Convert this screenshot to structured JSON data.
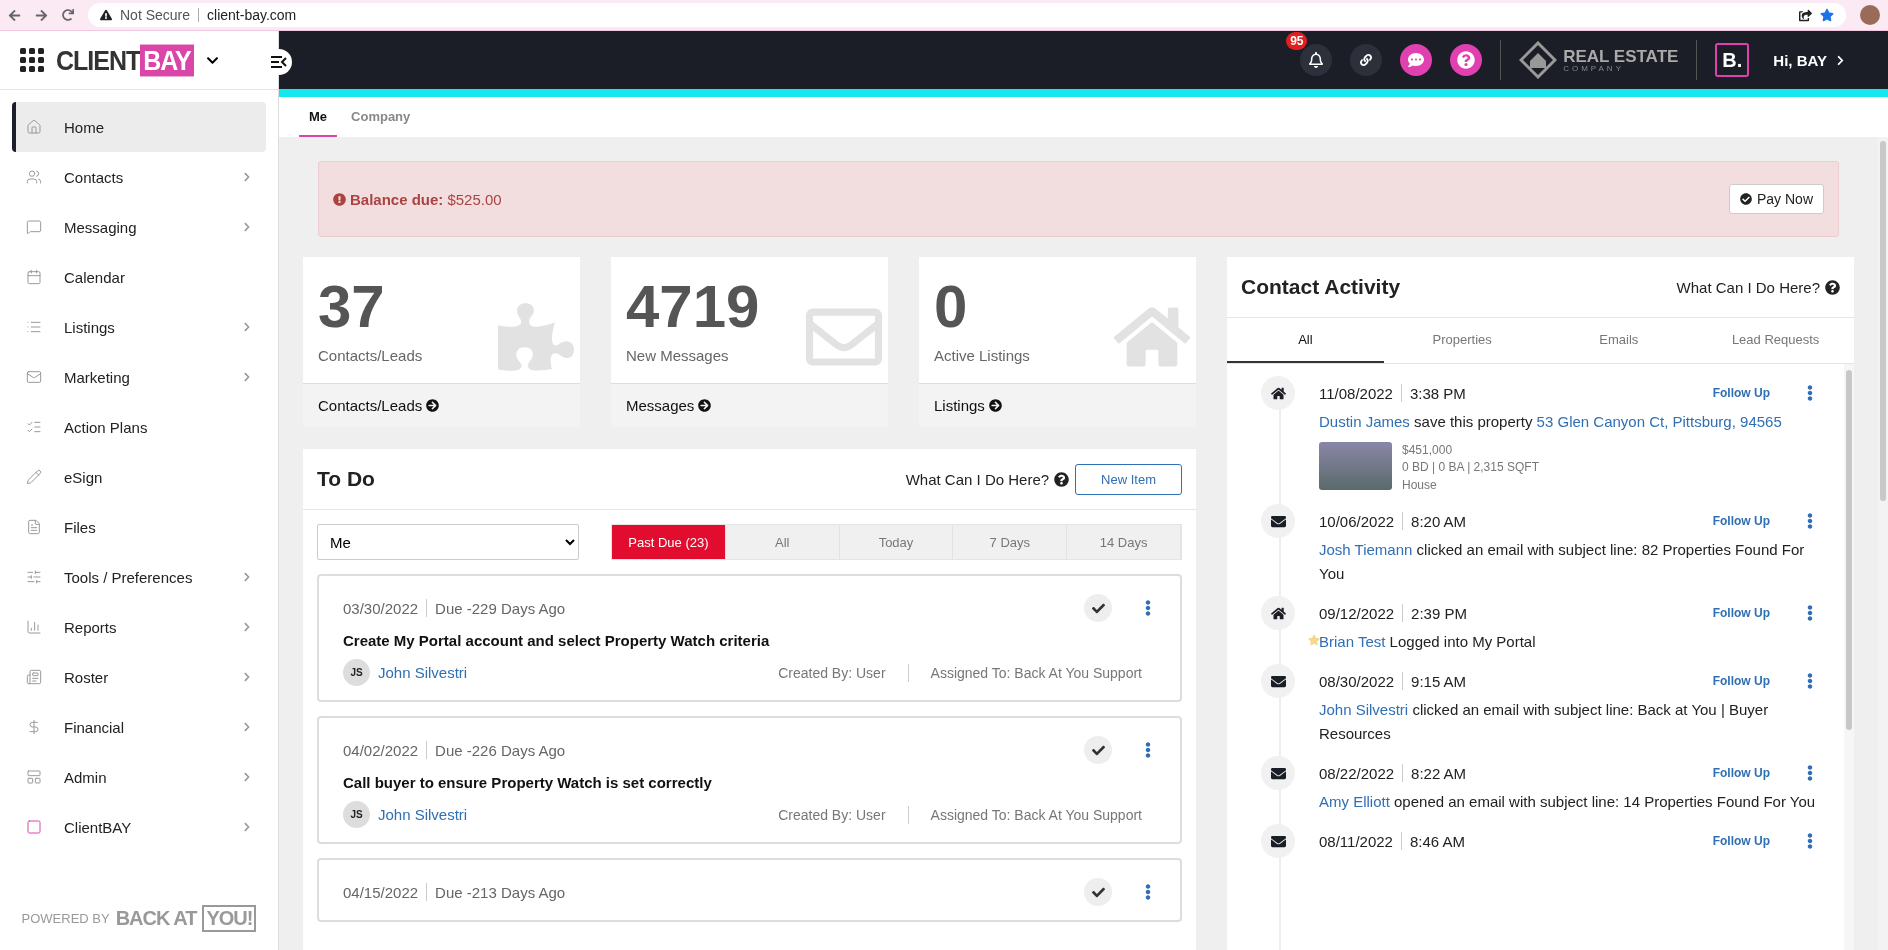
{
  "browser": {
    "security": "Not Secure",
    "url": "client-bay.com"
  },
  "sidebar": {
    "logo": {
      "word": "CLIENT",
      "highlight": "BAY"
    },
    "items": [
      {
        "label": "Home",
        "selected": true,
        "has_submenu": false
      },
      {
        "label": "Contacts",
        "selected": false,
        "has_submenu": true
      },
      {
        "label": "Messaging",
        "selected": false,
        "has_submenu": true
      },
      {
        "label": "Calendar",
        "selected": false,
        "has_submenu": false
      },
      {
        "label": "Listings",
        "selected": false,
        "has_submenu": true
      },
      {
        "label": "Marketing",
        "selected": false,
        "has_submenu": true
      },
      {
        "label": "Action Plans",
        "selected": false,
        "has_submenu": false
      },
      {
        "label": "eSign",
        "selected": false,
        "has_submenu": false
      },
      {
        "label": "Files",
        "selected": false,
        "has_submenu": false
      },
      {
        "label": "Tools / Preferences",
        "selected": false,
        "has_submenu": true
      },
      {
        "label": "Reports",
        "selected": false,
        "has_submenu": true
      },
      {
        "label": "Roster",
        "selected": false,
        "has_submenu": true
      },
      {
        "label": "Financial",
        "selected": false,
        "has_submenu": true
      },
      {
        "label": "Admin",
        "selected": false,
        "has_submenu": true
      },
      {
        "label": "ClientBAY",
        "selected": false,
        "has_submenu": true
      }
    ],
    "footer": {
      "prefix": "POWERED BY",
      "brand": "BACK AT",
      "brand_box": "YOU!"
    }
  },
  "header": {
    "notifications": "95",
    "company": {
      "name": "REAL ESTATE",
      "sub": "COMPANY"
    },
    "brand_mark": "B.",
    "greeting": "Hi, BAY"
  },
  "tabs": [
    {
      "label": "Me",
      "selected": true
    },
    {
      "label": "Company",
      "selected": false
    }
  ],
  "alert": {
    "label": "Balance due:",
    "amount": "$525.00",
    "button": "Pay Now"
  },
  "stats": [
    {
      "kind": "contacts",
      "value": "37",
      "caption": "Contacts/Leads",
      "link": "Contacts/Leads"
    },
    {
      "kind": "messages",
      "value": "4719",
      "caption": "New Messages",
      "link": "Messages"
    },
    {
      "kind": "listings",
      "value": "0",
      "caption": "Active Listings",
      "link": "Listings"
    }
  ],
  "todo": {
    "title": "To Do",
    "help": "What Can I Do Here?",
    "new_button": "New Item",
    "assignee": "Me",
    "filters": [
      {
        "label": "Past Due (23)",
        "selected": true
      },
      {
        "label": "All",
        "selected": false
      },
      {
        "label": "Today",
        "selected": false
      },
      {
        "label": "7 Days",
        "selected": false
      },
      {
        "label": "14 Days",
        "selected": false
      }
    ],
    "items": [
      {
        "date": "03/30/2022",
        "due": "Due -229 Days Ago",
        "title": "Create My Portal account and select Property Watch criteria",
        "initials": "JS",
        "contact": "John Silvestri",
        "created": "Created By: User",
        "assigned": "Assigned To: Back At You Support"
      },
      {
        "date": "04/02/2022",
        "due": "Due -226 Days Ago",
        "title": "Call buyer to ensure Property Watch is set correctly",
        "initials": "JS",
        "contact": "John Silvestri",
        "created": "Created By: User",
        "assigned": "Assigned To: Back At You Support"
      },
      {
        "date": "04/15/2022",
        "due": "Due -213 Days Ago"
      }
    ]
  },
  "activity": {
    "title": "Contact Activity",
    "help": "What Can I Do Here?",
    "tabs": [
      {
        "label": "All",
        "selected": true
      },
      {
        "label": "Properties",
        "selected": false
      },
      {
        "label": "Emails",
        "selected": false
      },
      {
        "label": "Lead Requests",
        "selected": false
      }
    ],
    "items": [
      {
        "kind": "property",
        "date": "11/08/2022",
        "time": "3:38 PM",
        "action_button": "Follow Up",
        "contact": "Dustin James",
        "text": "save this property",
        "link": "53 Glen Canyon Ct, Pittsburg, 94565",
        "starred": false,
        "listing": {
          "price": "$451,000",
          "specs": "0 BD | 0 BA | 2,315 SQFT",
          "type": "House"
        }
      },
      {
        "kind": "email",
        "date": "10/06/2022",
        "time": "8:20 AM",
        "action_button": "Follow Up",
        "contact": "Josh Tiemann",
        "text": "clicked an email with subject line: 82 Properties Found For You",
        "starred": false
      },
      {
        "kind": "property",
        "date": "09/12/2022",
        "time": "2:39 PM",
        "action_button": "Follow Up",
        "contact": "Brian Test",
        "text": "Logged into My Portal",
        "starred": true
      },
      {
        "kind": "email",
        "date": "08/30/2022",
        "time": "9:15 AM",
        "action_button": "Follow Up",
        "contact": "John Silvestri",
        "text": "clicked an email with subject line: Back at You | Buyer Resources",
        "starred": false
      },
      {
        "kind": "email",
        "date": "08/22/2022",
        "time": "8:22 AM",
        "action_button": "Follow Up",
        "contact": "Amy Elliott",
        "text": "opened an email with subject line: 14 Properties Found For You",
        "starred": false
      },
      {
        "kind": "email",
        "date": "08/11/2022",
        "time": "8:46 AM",
        "action_button": "Follow Up",
        "starred": false
      }
    ]
  }
}
